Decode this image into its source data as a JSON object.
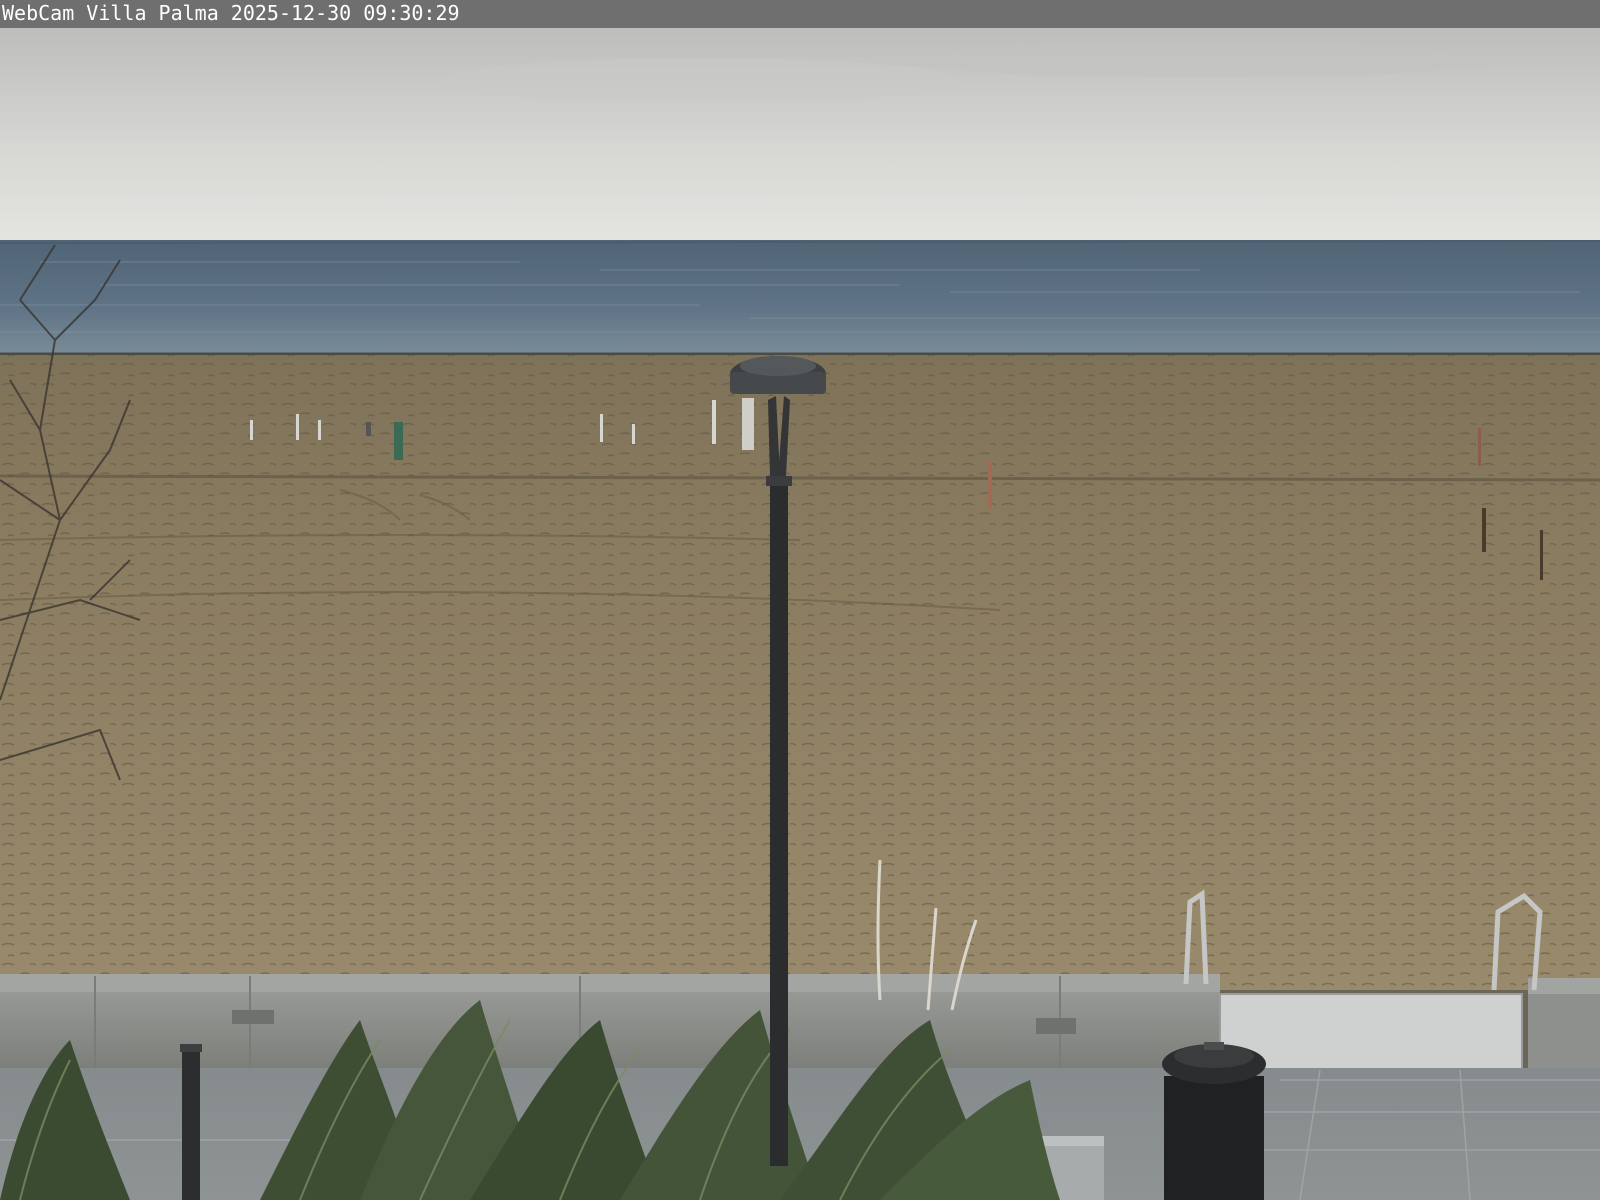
{
  "overlay": {
    "caption": "WebCam Villa Palma 2025-12-30 09:30:29"
  },
  "colors": {
    "sky_top": "#c4c5c3",
    "sky_horizon": "#e2e2df",
    "sea_far": "#52677a",
    "sea_near": "#6b8091",
    "sand": "#958567",
    "sand_dark": "#6e6149",
    "wall": "#8d8f8c",
    "pavement": "#7f8486",
    "grass": "#3f4f34"
  },
  "scene": {
    "objects": [
      "lamp-post",
      "trash-bin",
      "ornamental-grass",
      "beach-poles",
      "bare-tree",
      "concrete-wall",
      "stair-railings",
      "gate-panel",
      "paved-terrace",
      "bollard",
      "bench"
    ]
  }
}
